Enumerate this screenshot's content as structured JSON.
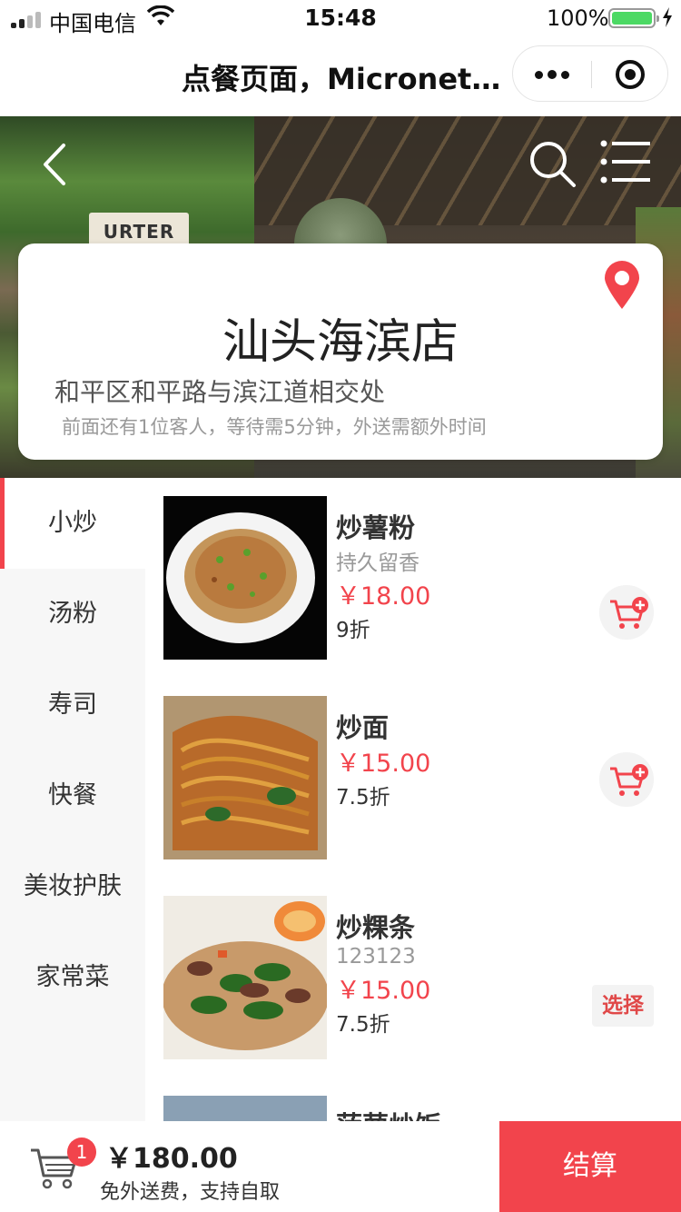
{
  "status_bar": {
    "carrier": "中国电信",
    "time": "15:48",
    "battery_percent": "100%",
    "battery_level": 1.0,
    "icons": [
      "signal-icon",
      "wifi-icon",
      "battery-icon",
      "charging-icon"
    ]
  },
  "nav": {
    "title": "点餐页面，Micronet...",
    "icons": [
      "more-icon",
      "target-icon"
    ]
  },
  "banner": {
    "sign_text": "URTER",
    "icons": [
      "back-icon",
      "search-icon",
      "menu-icon"
    ]
  },
  "store": {
    "name": "汕头海滨店",
    "address": "和平区和平路与滨江道相交处",
    "wait_info": "前面还有1位客人，等待需5分钟，外送需额外时间",
    "icon": "location-pin-icon"
  },
  "categories": [
    {
      "label": "小炒",
      "active": true
    },
    {
      "label": "汤粉",
      "active": false
    },
    {
      "label": "寿司",
      "active": false
    },
    {
      "label": "快餐",
      "active": false
    },
    {
      "label": "美妆护肤",
      "active": false
    },
    {
      "label": "家常菜",
      "active": false
    }
  ],
  "dishes": [
    {
      "name": "炒薯粉",
      "desc": "持久留香",
      "price": "￥18.00",
      "discount": "9折",
      "action": "add-to-cart-icon"
    },
    {
      "name": "炒面",
      "desc": "",
      "price": "￥15.00",
      "discount": "7.5折",
      "action": "add-to-cart-icon"
    },
    {
      "name": "炒粿条",
      "desc": "123123",
      "price": "￥15.00",
      "discount": "7.5折",
      "action_label": "选择"
    },
    {
      "name": "菠萝炒饭",
      "desc": "",
      "price": "",
      "discount": ""
    }
  ],
  "bottom": {
    "cart_count": "1",
    "total": "￥180.00",
    "shipping_note": "免外送费，支持自取",
    "checkout_label": "结算"
  },
  "colors": {
    "accent": "#f2444c",
    "battery": "#4cd964",
    "sidebar_bg": "#f7f7f7"
  }
}
